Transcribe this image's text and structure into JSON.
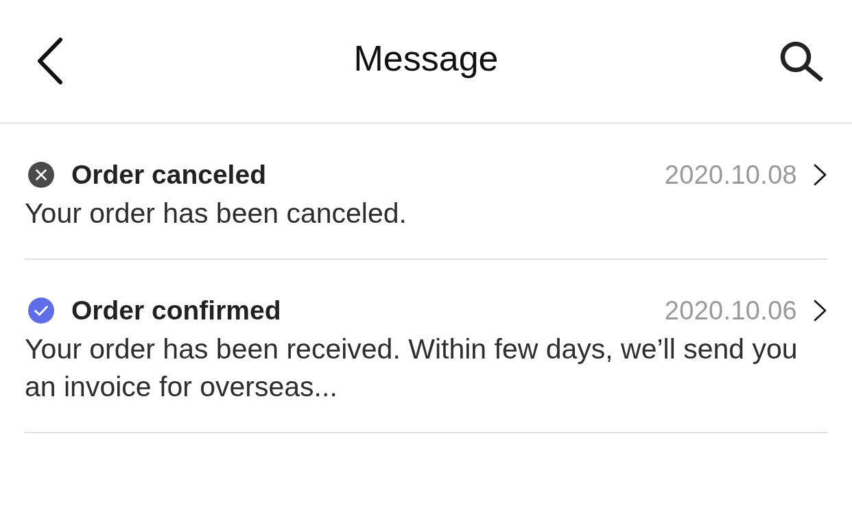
{
  "header": {
    "title": "Message"
  },
  "messages": [
    {
      "kind": "canceled",
      "color": "#4a4a4a",
      "title": "Order canceled",
      "date": "2020.10.08",
      "body": "Your order has been canceled."
    },
    {
      "kind": "confirmed",
      "color": "#5f6de6",
      "title": "Order confirmed",
      "date": "2020.10.06",
      "body": "Your order has been received. Within few days, we’ll send you an invoice for overseas..."
    }
  ]
}
